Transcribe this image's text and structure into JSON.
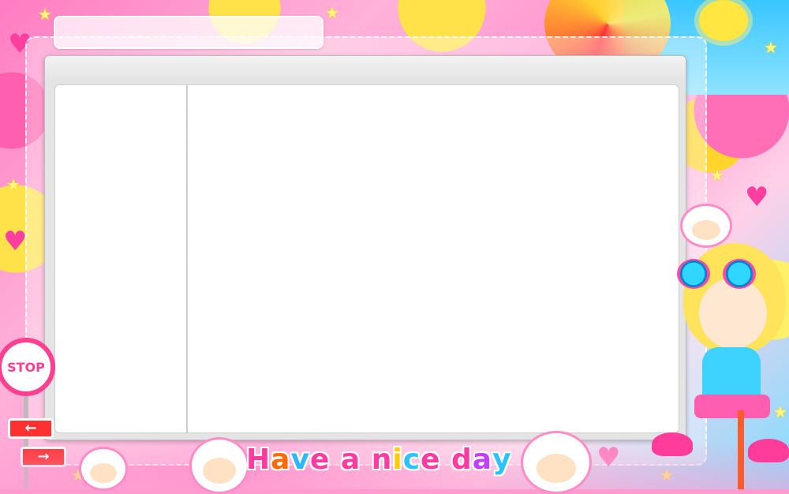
{
  "tagline": {
    "letters": [
      "H",
      "a",
      "v",
      "e",
      " ",
      "a",
      " ",
      "n",
      "i",
      "c",
      "e",
      " ",
      "d",
      "a",
      "y"
    ],
    "colors": [
      "#ff3aa0",
      "#ff6a00",
      "#2db7ff",
      "#ff3aa0",
      "#ffffff",
      "#ff3aa0",
      "#ffffff",
      "#ff3aa0",
      "#ffcc00",
      "#29c4ff",
      "#ff3aa0",
      "#ffffff",
      "#ff3aa0",
      "#c23fff",
      "#29c4ff"
    ]
  },
  "signs": {
    "stop": "STOP"
  },
  "colors": {
    "accent_pink": "#ff3f8f",
    "window_gray": "#e4e4e4",
    "pane_white": "#ffffff"
  }
}
